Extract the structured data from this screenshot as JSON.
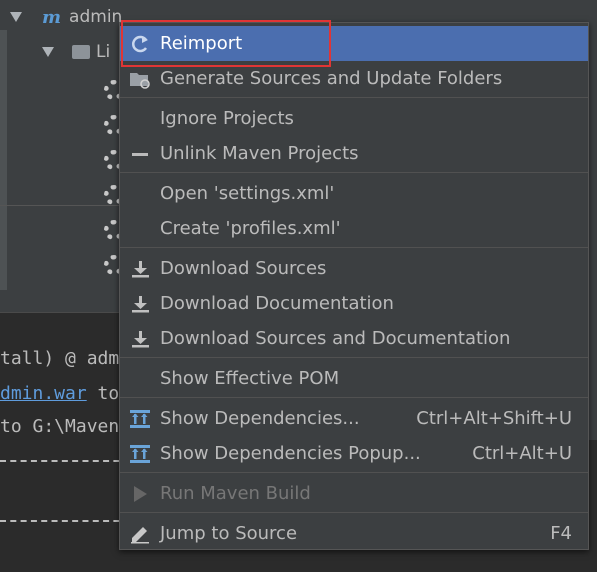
{
  "tree": {
    "root_label": "admin",
    "child_label": "Li",
    "maven_glyph": "m"
  },
  "console": {
    "line1": "tall) @ adm",
    "line2_link": "dmin.war",
    "line2_rest": " to",
    "line3": "to G:\\Maven"
  },
  "menu": {
    "items": [
      {
        "label": "Reimport",
        "icon": "refresh-icon",
        "selected": true
      },
      {
        "label": "Generate Sources and Update Folders",
        "icon": "folder-refresh-icon"
      },
      {
        "label": "Ignore Projects",
        "icon": ""
      },
      {
        "label": "Unlink Maven Projects",
        "icon": "minus-icon"
      },
      {
        "label": "Open 'settings.xml'",
        "icon": ""
      },
      {
        "label": "Create 'profiles.xml'",
        "icon": ""
      },
      {
        "label": "Download Sources",
        "icon": "download-icon"
      },
      {
        "label": "Download Documentation",
        "icon": "download-icon"
      },
      {
        "label": "Download Sources and Documentation",
        "icon": "download-icon"
      },
      {
        "label": "Show Effective POM",
        "icon": ""
      },
      {
        "label": "Show Dependencies...",
        "icon": "dependencies-icon",
        "shortcut": "Ctrl+Alt+Shift+U"
      },
      {
        "label": "Show Dependencies Popup...",
        "icon": "dependencies-icon",
        "shortcut": "Ctrl+Alt+U"
      },
      {
        "label": "Run Maven Build",
        "icon": "run-icon",
        "disabled": true
      },
      {
        "label": "Jump to Source",
        "icon": "pencil-icon",
        "shortcut": "F4"
      }
    ]
  },
  "colors": {
    "selection": "#4b6eaf",
    "menu_bg": "#3c3f41",
    "highlight_border": "#e03535",
    "text": "#bbbbbb"
  }
}
